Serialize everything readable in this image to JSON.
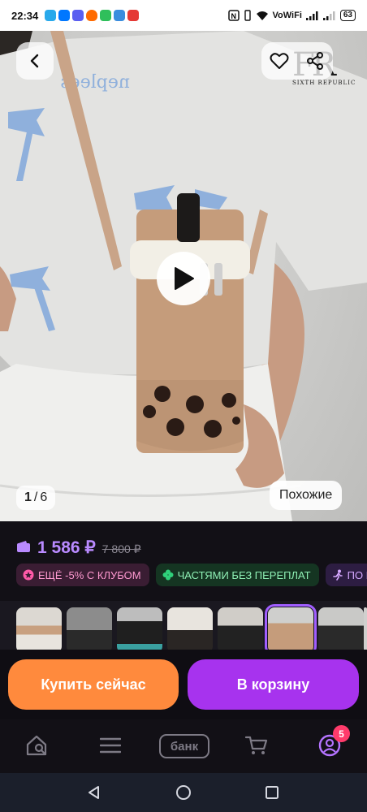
{
  "status_bar": {
    "time": "22:34",
    "network_label": "VoWiFi",
    "battery": "63",
    "app_icons": [
      "telegram-icon",
      "vk-icon",
      "messenger-icon",
      "fire-icon",
      "check-app-icon",
      "snowflake-app-icon",
      "maps-icon"
    ],
    "app_icon_colors": [
      "#29a9eb",
      "#0077ff",
      "#5b5ff0",
      "#ff6a00",
      "#2fbf5b",
      "#3a8dde",
      "#e53935"
    ]
  },
  "product_media": {
    "watermark_big": "FR",
    "watermark_small": "SIXTH REPUBLIC",
    "shirt_print_text": "neplees",
    "image_counter_current": "1",
    "image_counter_total": "6",
    "similar_label": "Похожие"
  },
  "price": {
    "current": "1 586 ₽",
    "old": "7 800 ₽",
    "accent_color": "#b98aff"
  },
  "badges": [
    {
      "label": "ЕЩЁ -5% С КЛУБОМ",
      "icon": "star-badge-icon"
    },
    {
      "label": "ЧАСТЯМИ БЕЗ ПЕРЕПЛАТ",
      "icon": "clover-icon"
    },
    {
      "label": "ПО КЛ",
      "icon": "running-person-icon"
    }
  ],
  "thumbnails": {
    "count": 8,
    "active_index": 5
  },
  "actions": {
    "buy_now": "Купить сейчас",
    "add_to_cart": "В корзину",
    "buy_color": "#ff8a3d",
    "cart_color": "#a733ee"
  },
  "tabbar": {
    "bank_label": "банк",
    "profile_badge": "5",
    "icons": [
      "home-search-icon",
      "catalog-icon",
      "bank-icon",
      "cart-icon",
      "profile-icon"
    ]
  }
}
